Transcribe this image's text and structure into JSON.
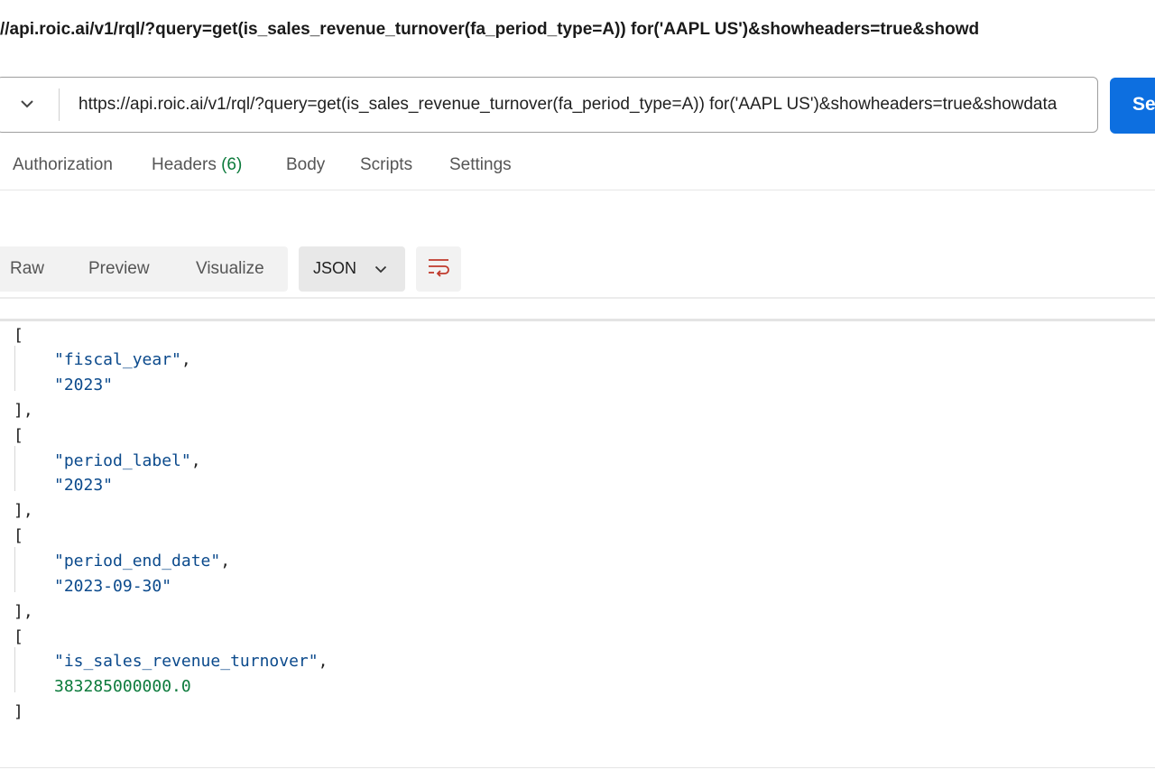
{
  "request": {
    "title": "//api.roic.ai/v1/rql/?query=get(is_sales_revenue_turnover(fa_period_type=A)) for('AAPL US')&showheaders=true&showd",
    "url": "https://api.roic.ai/v1/rql/?query=get(is_sales_revenue_turnover(fa_period_type=A)) for('AAPL US')&showheaders=true&showdata",
    "send_label": "Se",
    "method_icon": "chevron-down-icon"
  },
  "request_tabs": [
    {
      "label": "Authorization"
    },
    {
      "label": "Headers",
      "count": "(6)"
    },
    {
      "label": "Body"
    },
    {
      "label": "Scripts"
    },
    {
      "label": "Settings"
    }
  ],
  "response": {
    "view_tabs": [
      "Raw",
      "Preview",
      "Visualize"
    ],
    "format": "JSON",
    "wrap_icon": "wrap-lines-icon"
  },
  "json_lines": [
    {
      "text": "["
    },
    {
      "text": "\"fiscal_year\"",
      "suffix": ","
    },
    {
      "text": "\"2023\""
    },
    {
      "text": "],"
    },
    {
      "text": "["
    },
    {
      "text": "\"period_label\"",
      "suffix": ","
    },
    {
      "text": "\"2023\""
    },
    {
      "text": "],"
    },
    {
      "text": "["
    },
    {
      "text": "\"period_end_date\"",
      "suffix": ","
    },
    {
      "text": "\"2023-09-30\""
    },
    {
      "text": "],"
    },
    {
      "text": "["
    },
    {
      "text": "\"is_sales_revenue_turnover\"",
      "suffix": ","
    },
    {
      "text": "383285000000.0"
    },
    {
      "text": "]"
    }
  ],
  "colors": {
    "send": "#0d6fe0",
    "string": "#0b4a8c",
    "number": "#0b7a3b",
    "count": "#0b7a3b",
    "wrap_icon": "#c0392b"
  }
}
